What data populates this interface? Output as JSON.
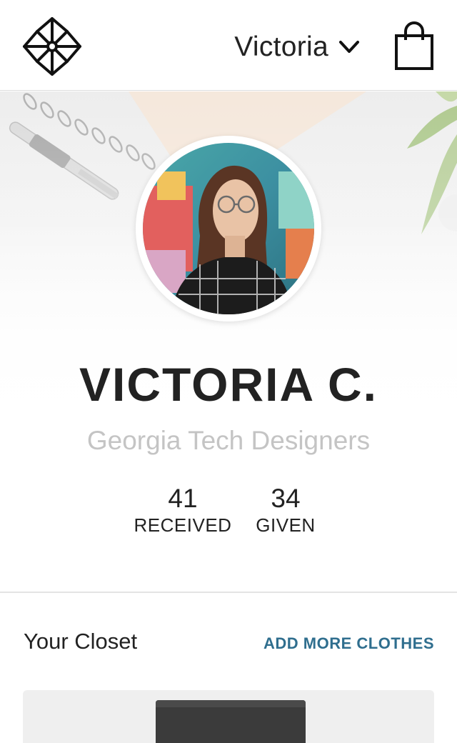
{
  "header": {
    "logo_icon": "pinwheel-logo-icon",
    "user_name": "Victoria",
    "dropdown_icon": "chevron-down-icon",
    "cart_icon": "shopping-bag-icon"
  },
  "profile": {
    "name": "VICTORIA C.",
    "group": "Georgia Tech Designers",
    "avatar_icon": "profile-photo"
  },
  "stats": {
    "received": {
      "value": "41",
      "label": "RECEIVED"
    },
    "given": {
      "value": "34",
      "label": "GIVEN"
    }
  },
  "closet": {
    "title": "Your Closet",
    "add_label": "ADD MORE CLOTHES"
  },
  "colors": {
    "accent": "#2f6e8e",
    "text": "#222222",
    "muted": "#c4c4c4"
  }
}
